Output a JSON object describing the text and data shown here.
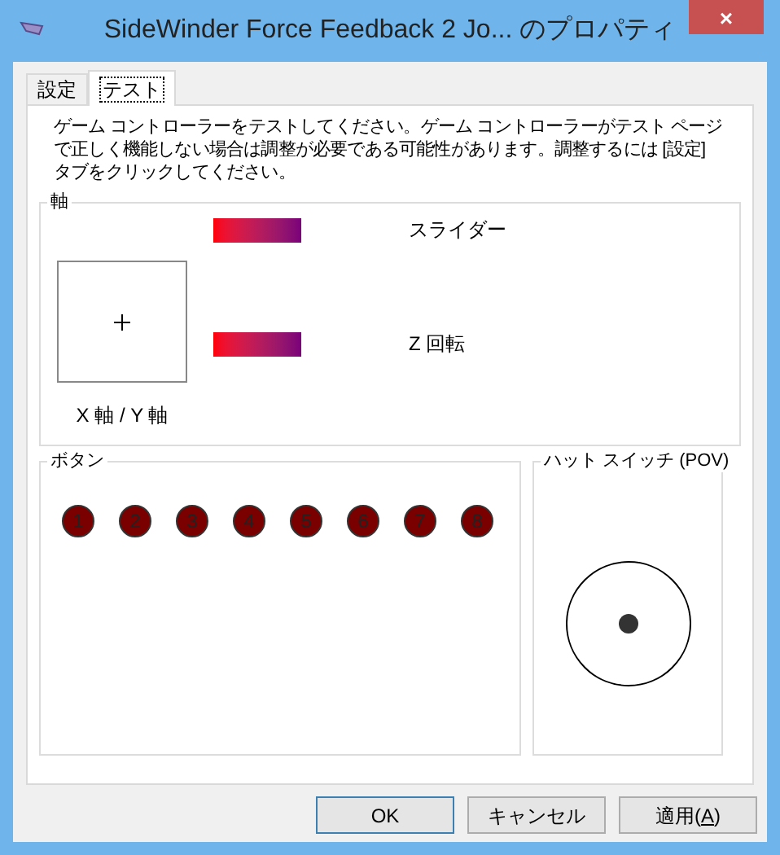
{
  "window": {
    "title": "SideWinder Force Feedback 2 Jo... のプロパティ",
    "close": "×"
  },
  "tabs": [
    {
      "label": "設定",
      "selected": false
    },
    {
      "label": "テスト",
      "selected": true
    }
  ],
  "instructions": "ゲーム コントローラーをテストしてください。ゲーム コントローラーがテスト ページで正しく機能しない場合は調整が必要である可能性があります。調整するには [設定] タブをクリックしてください。",
  "axes": {
    "title": "軸",
    "xy_label": "X 軸 / Y 軸",
    "bars": [
      {
        "label": "スライダー"
      },
      {
        "label": "Z 回転"
      }
    ]
  },
  "buttons_group": {
    "title": "ボタン",
    "buttons": [
      {
        "label": "1",
        "pressed": false
      },
      {
        "label": "2",
        "pressed": false
      },
      {
        "label": "3",
        "pressed": false
      },
      {
        "label": "4",
        "pressed": false
      },
      {
        "label": "5",
        "pressed": false
      },
      {
        "label": "6",
        "pressed": false
      },
      {
        "label": "7",
        "pressed": false
      },
      {
        "label": "8",
        "pressed": false
      }
    ]
  },
  "pov": {
    "title": "ハット スイッチ (POV)"
  },
  "dialog_buttons": [
    {
      "label_before": "OK",
      "default": true
    },
    {
      "label_before": "キャンセル",
      "default": false
    },
    {
      "label_before": "適用(",
      "accelerator": "A",
      "label_after": ")",
      "default": false
    }
  ]
}
